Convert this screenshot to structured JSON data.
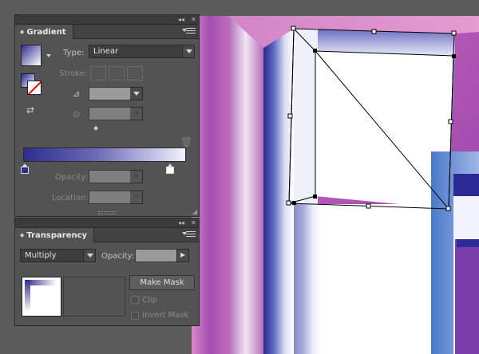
{
  "gradient_panel": {
    "tab_label": "Gradient",
    "type_label": "Type:",
    "type_value": "Linear",
    "stroke_label": "Stroke:",
    "opacity_label": "Opacity:",
    "location_label": "Location:",
    "gradient_start_color": "#2e2d8e",
    "gradient_end_color": "#ffffff"
  },
  "transparency_panel": {
    "tab_label": "Transparency",
    "blend_mode": "Multiply",
    "opacity_label": "Opacity:",
    "make_mask_label": "Make Mask",
    "clip_label": "Clip",
    "invert_mask_label": "Invert Mask"
  },
  "colors": {
    "panel_bg": "#535353",
    "artwork_magenta": "#c050b0",
    "artwork_blue": "#2b2a8e",
    "selection": "#000000"
  }
}
